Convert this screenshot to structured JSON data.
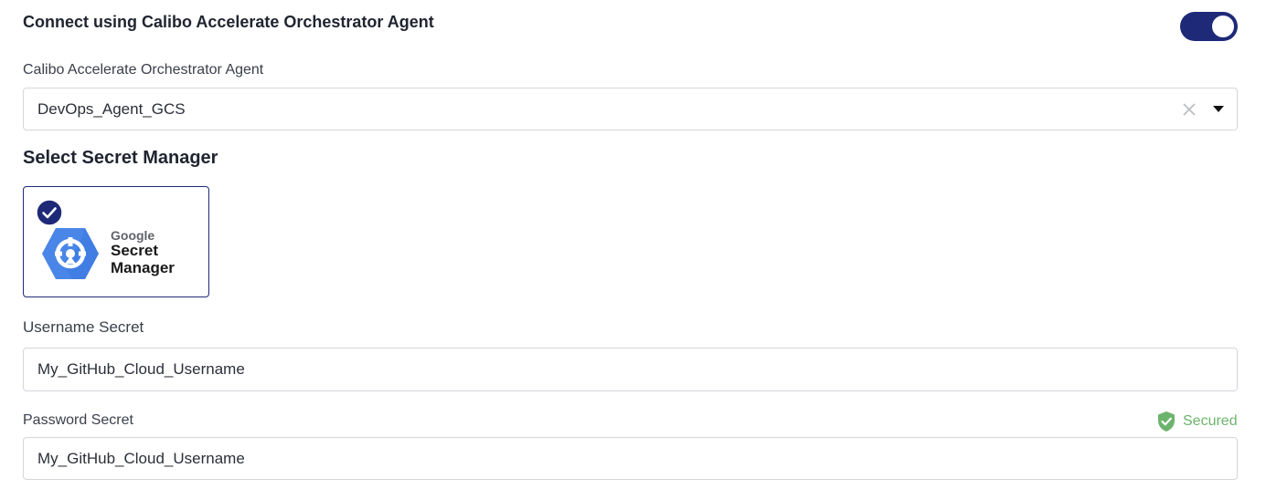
{
  "connect": {
    "title": "Connect using Calibo Accelerate Orchestrator Agent",
    "toggle_on": true
  },
  "agent_field": {
    "label": "Calibo Accelerate Orchestrator Agent",
    "value": "DevOps_Agent_GCS"
  },
  "secret_manager": {
    "title": "Select Secret Manager",
    "card": {
      "brand": "Google",
      "name_line1": "Secret",
      "name_line2": "Manager",
      "selected": true
    }
  },
  "username_field": {
    "label": "Username Secret",
    "value": "My_GitHub_Cloud_Username"
  },
  "password_field": {
    "label": "Password Secret",
    "value": "My_GitHub_Cloud_Username",
    "status": "Secured"
  },
  "colors": {
    "accent": "#1e2a78",
    "secured": "#6cb46c",
    "google_blue": "#4a86e8"
  }
}
